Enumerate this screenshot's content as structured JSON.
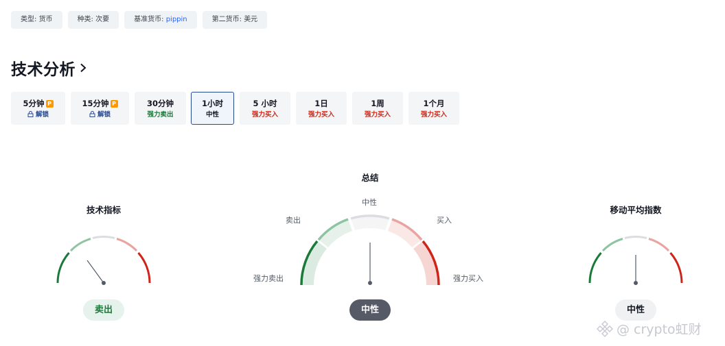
{
  "tags": [
    {
      "label": "类型: ",
      "value": "货币",
      "link": false
    },
    {
      "label": "种类: ",
      "value": "次要",
      "link": false
    },
    {
      "label": "基准货币: ",
      "value": "pippin",
      "link": true
    },
    {
      "label": "第二货币: ",
      "value": "美元",
      "link": false
    }
  ],
  "section_title": "技术分析",
  "tabs": [
    {
      "label": "5分钟",
      "status": "解锁",
      "locked": true,
      "kind": "lock"
    },
    {
      "label": "15分钟",
      "status": "解锁",
      "locked": true,
      "kind": "lock"
    },
    {
      "label": "30分钟",
      "status": "强力卖出",
      "locked": false,
      "kind": "sell-strong"
    },
    {
      "label": "1小时",
      "status": "中性",
      "locked": false,
      "kind": "neutral",
      "active": true
    },
    {
      "label": "5 小时",
      "status": "强力买入",
      "locked": false,
      "kind": "buy"
    },
    {
      "label": "1日",
      "status": "强力买入",
      "locked": false,
      "kind": "buy"
    },
    {
      "label": "1周",
      "status": "强力买入",
      "locked": false,
      "kind": "buy"
    },
    {
      "label": "1个月",
      "status": "强力买入",
      "locked": false,
      "kind": "buy"
    }
  ],
  "pro_badge": "P",
  "gauges": {
    "oscillators": {
      "title": "技术指标",
      "result": "卖出"
    },
    "summary": {
      "title": "总结",
      "result": "中性",
      "labels": {
        "strong_sell": "强力卖出",
        "sell": "卖出",
        "neutral": "中性",
        "buy": "买入",
        "strong_buy": "强力买入"
      }
    },
    "moving_averages": {
      "title": "移动平均指数",
      "result": "中性"
    }
  },
  "watermark": "@ crypto虹财",
  "colors": {
    "strong_sell": "#1b7a3a",
    "sell": "#8fc4a3",
    "neutral": "#dcdde0",
    "buy": "#e9a3a0",
    "strong_buy": "#cf2418",
    "link": "#2962ff"
  }
}
